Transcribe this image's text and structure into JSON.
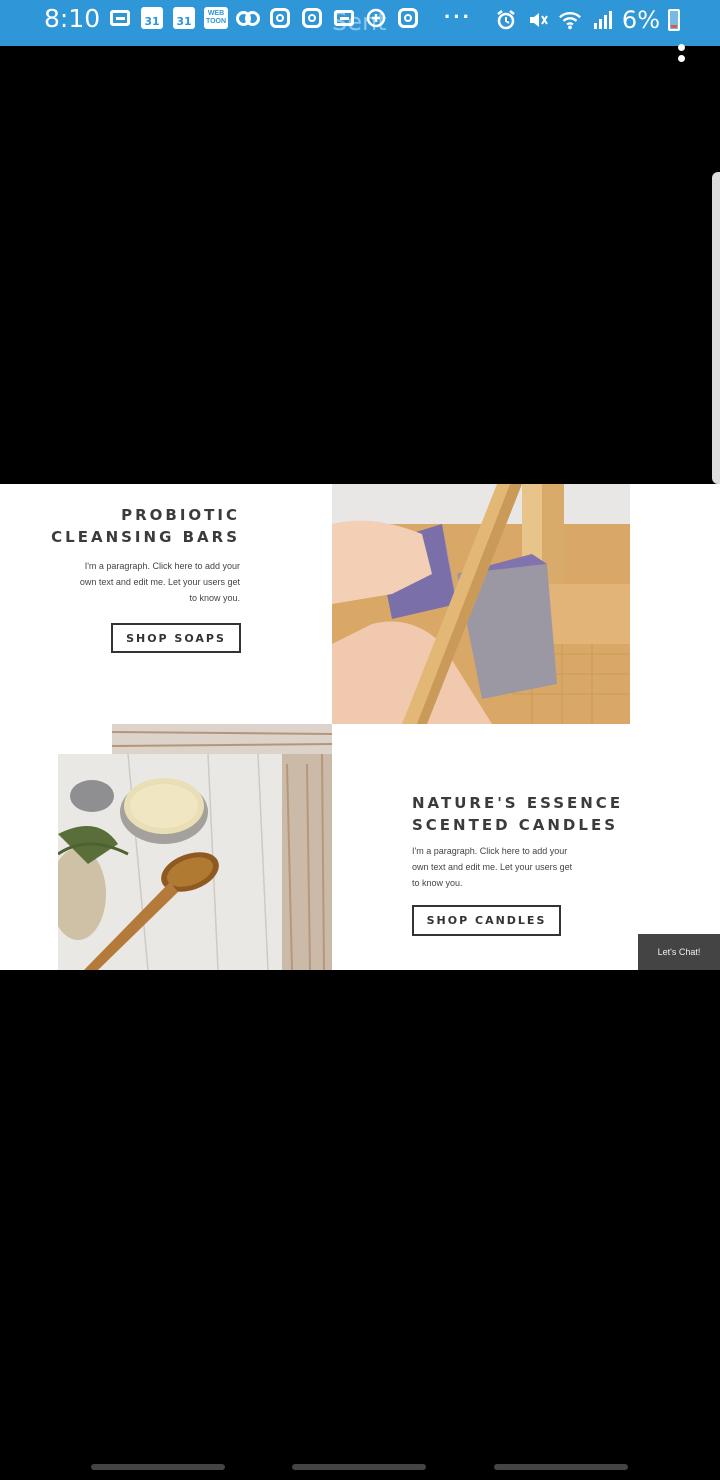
{
  "status_bar": {
    "time": "8:10",
    "cal_1": "31",
    "cal_2": "31",
    "webtoon": "WEB TOON",
    "overlay_text": "Sent",
    "more": "···",
    "battery_percent": "6%"
  },
  "section_1": {
    "title_line1": "PROBIOTIC",
    "title_line2": "CLEANSING BARS",
    "para_line1": "I'm a paragraph. Click here to add your",
    "para_line2": "own text and edit me. Let your users get",
    "para_line3": "to know you.",
    "button": "SHOP SOAPS"
  },
  "section_2": {
    "title_line1": "NATURE'S ESSENCE",
    "title_line2": "SCENTED CANDLES",
    "para_line1": "I'm a paragraph. Click here to add your",
    "para_line2": "own text and edit me. Let your users get",
    "para_line3": "to know you.",
    "button": "SHOP CANDLES"
  },
  "chat_button": "Let's Chat!",
  "icons": {
    "messages": "messages-icon",
    "calendar": "calendar-icon",
    "webtoon": "webtoon-icon",
    "voicemail": "voicemail-icon",
    "instagram": "instagram-icon",
    "alarm": "alarm-icon",
    "mute": "mute-icon",
    "wifi": "wifi-icon",
    "signal": "signal-icon",
    "battery": "battery-icon",
    "menu": "kebab-menu-icon"
  }
}
